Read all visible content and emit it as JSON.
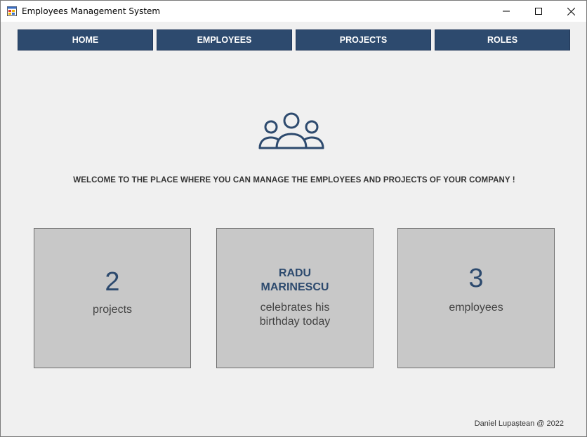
{
  "window": {
    "title": "Employees Management System",
    "icon": "app-window-icon",
    "controls": {
      "minimize": "minimize-icon",
      "maximize": "maximize-icon",
      "close": "close-icon"
    }
  },
  "nav": {
    "home": "HOME",
    "employees": "EMPLOYEES",
    "projects": "PROJECTS",
    "roles": "ROLES"
  },
  "hero": {
    "icon": "users-group-icon",
    "welcome": "WELCOME TO THE PLACE WHERE YOU CAN MANAGE THE EMPLOYEES AND PROJECTS OF YOUR COMPANY !"
  },
  "stats": {
    "projects": {
      "count": "2",
      "label": "projects"
    },
    "birthday": {
      "first_name": "RADU",
      "last_name": "MARINESCU",
      "line1": "celebrates his",
      "line2": "birthday today"
    },
    "employees": {
      "count": "3",
      "label": "employees"
    }
  },
  "footer": {
    "credit": "Daniel Lupaștean @ 2022"
  },
  "colors": {
    "accent": "#2d4a6e",
    "card": "#c8c8c8",
    "background": "#f0f0f0"
  }
}
